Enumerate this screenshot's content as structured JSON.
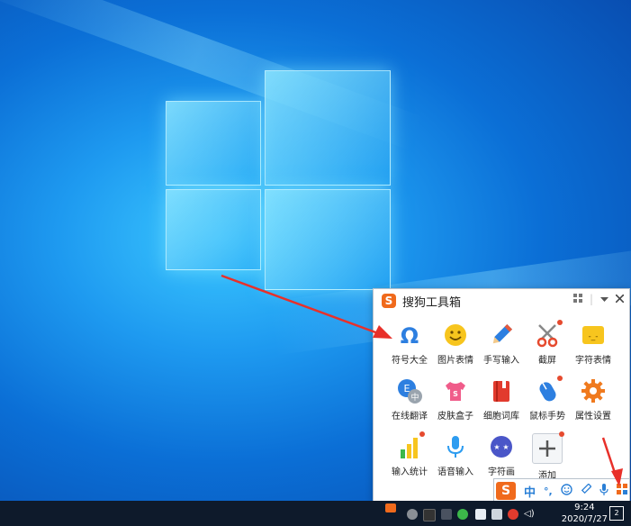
{
  "toolbox": {
    "title": "搜狗工具箱",
    "logo_text": "S",
    "tools": [
      {
        "label": "符号大全",
        "icon": "omega-icon",
        "badge": false
      },
      {
        "label": "图片表情",
        "icon": "smiley-icon",
        "badge": false
      },
      {
        "label": "手写输入",
        "icon": "pencil-icon",
        "badge": false
      },
      {
        "label": "截屏",
        "icon": "scissors-icon",
        "badge": true
      },
      {
        "label": "字符表情",
        "icon": "text-emoticon-icon",
        "badge": false
      },
      {
        "label": "在线翻译",
        "icon": "translate-icon",
        "badge": false
      },
      {
        "label": "皮肤盒子",
        "icon": "skin-shirt-icon",
        "badge": false
      },
      {
        "label": "细胞词库",
        "icon": "dictionary-book-icon",
        "badge": false
      },
      {
        "label": "鼠标手势",
        "icon": "mouse-icon",
        "badge": true
      },
      {
        "label": "属性设置",
        "icon": "gear-icon",
        "badge": false
      },
      {
        "label": "输入统计",
        "icon": "bar-chart-icon",
        "badge": true
      },
      {
        "label": "语音输入",
        "icon": "microphone-icon",
        "badge": false
      },
      {
        "label": "字符画",
        "icon": "face-art-icon",
        "badge": false
      },
      {
        "label": "添加",
        "icon": "plus-icon",
        "badge": true
      }
    ],
    "translate_sub": "E",
    "translate_sub2": "中",
    "emoticon_text": "-_-"
  },
  "ime_bar": {
    "logo_text": "S",
    "mode": "中",
    "punct": "°,",
    "icons": [
      "emoji-icon",
      "pen-icon",
      "mic-icon",
      "toolbox-grid-icon"
    ]
  },
  "taskbar": {
    "time": "9:24",
    "date": "2020/7/27",
    "notification_count": "2"
  },
  "colors": {
    "accent_orange": "#f06a1c",
    "arrow_red": "#e8302a",
    "taskbar": "#0e1a2b"
  }
}
